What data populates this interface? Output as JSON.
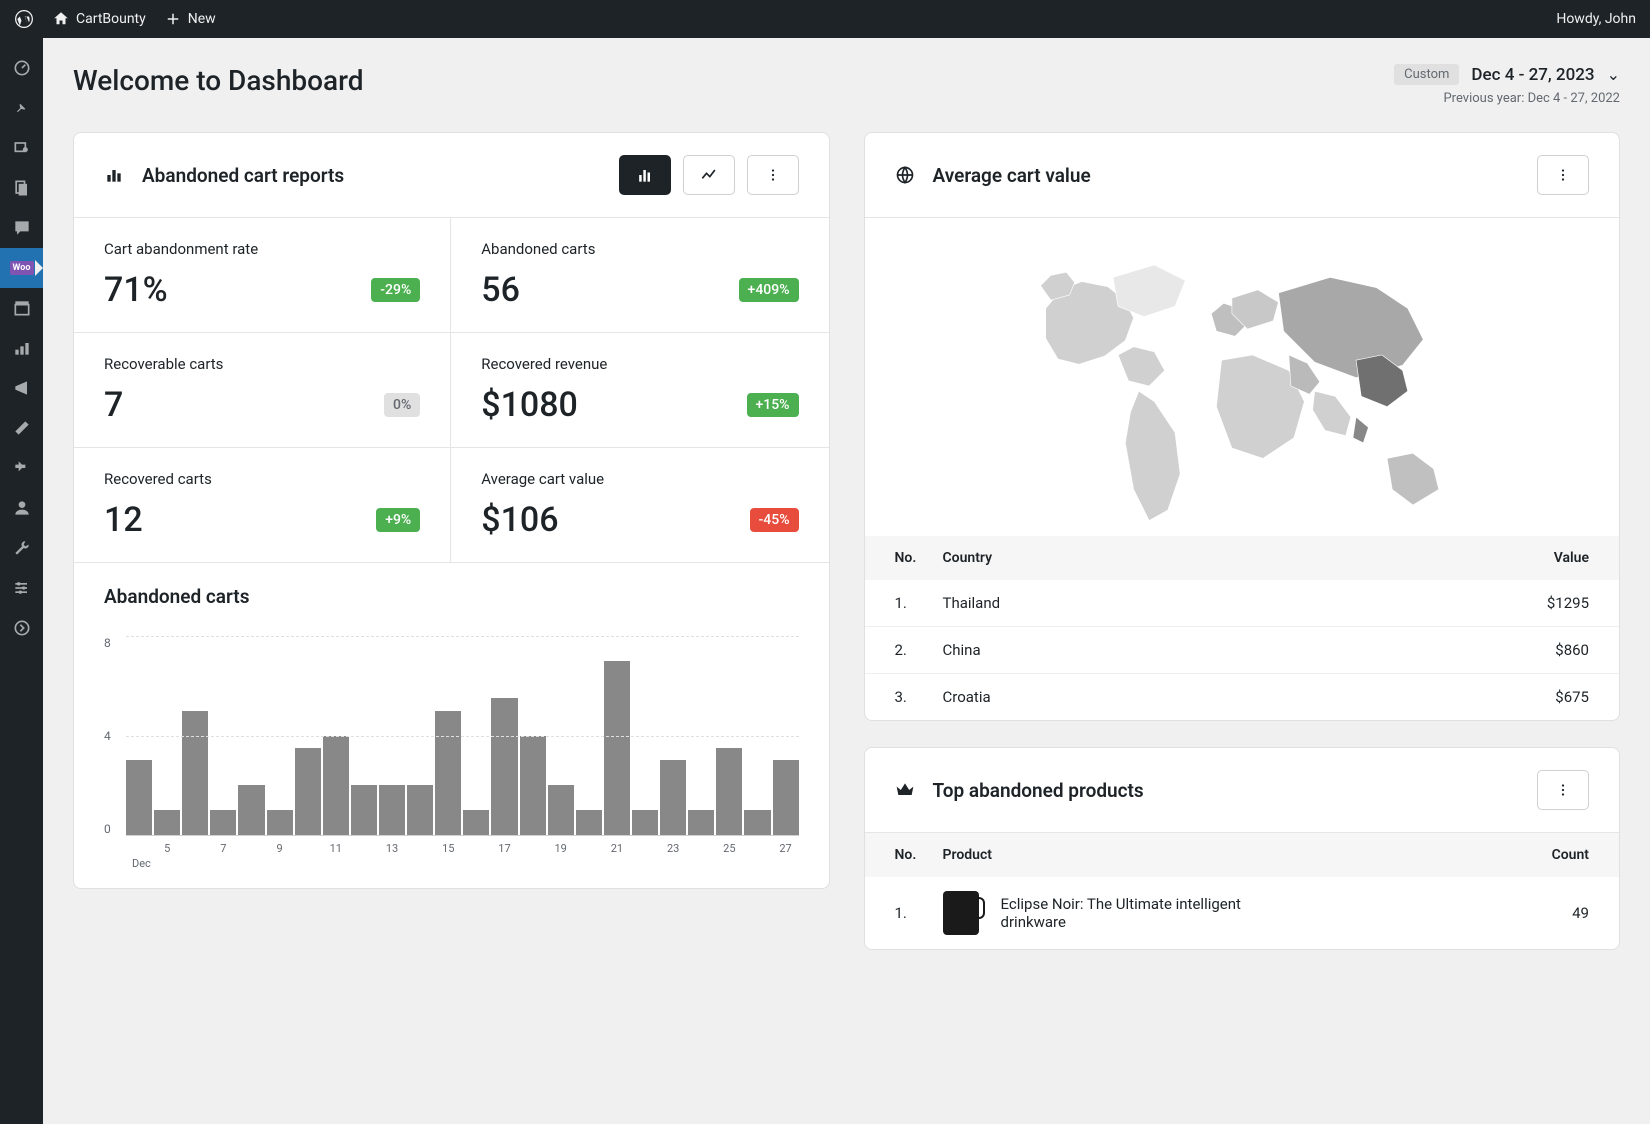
{
  "admin_bar": {
    "site_name": "CartBounty",
    "new_label": "New",
    "greeting": "Howdy, John"
  },
  "header": {
    "title": "Welcome to Dashboard",
    "custom_badge": "Custom",
    "date_range": "Dec 4 - 27, 2023",
    "previous_year": "Previous year: Dec 4 - 27, 2022"
  },
  "reports_card": {
    "title": "Abandoned cart reports",
    "stats": [
      {
        "label": "Cart abandonment rate",
        "value": "71%",
        "change": "-29%",
        "change_color": "green"
      },
      {
        "label": "Abandoned carts",
        "value": "56",
        "change": "+409%",
        "change_color": "green"
      },
      {
        "label": "Recoverable carts",
        "value": "7",
        "change": "0%",
        "change_color": "gray"
      },
      {
        "label": "Recovered revenue",
        "value": "$1080",
        "change": "+15%",
        "change_color": "green"
      },
      {
        "label": "Recovered carts",
        "value": "12",
        "change": "+9%",
        "change_color": "green"
      },
      {
        "label": "Average cart value",
        "value": "$106",
        "change": "-45%",
        "change_color": "red"
      }
    ]
  },
  "chart": {
    "title": "Abandoned carts",
    "y_ticks": [
      "8",
      "4",
      "0"
    ],
    "x_month": "Dec"
  },
  "chart_data": {
    "type": "bar",
    "title": "Abandoned carts",
    "xlabel": "Dec",
    "ylabel": "",
    "ylim": [
      0,
      8
    ],
    "categories": [
      "4",
      "5",
      "6",
      "7",
      "8",
      "9",
      "10",
      "11",
      "12",
      "13",
      "14",
      "15",
      "16",
      "17",
      "18",
      "19",
      "20",
      "21",
      "22",
      "23",
      "24",
      "25",
      "26",
      "27"
    ],
    "x_tick_labels": [
      "",
      "5",
      "",
      "7",
      "",
      "9",
      "",
      "11",
      "",
      "13",
      "",
      "15",
      "",
      "17",
      "",
      "19",
      "",
      "21",
      "",
      "23",
      "",
      "25",
      "",
      "27"
    ],
    "values": [
      3,
      1,
      5,
      1,
      2,
      1,
      3.5,
      4,
      2,
      2,
      2,
      5,
      1,
      5.5,
      4,
      2,
      1,
      7,
      1,
      3,
      1,
      3.5,
      1,
      3
    ]
  },
  "map_card": {
    "title": "Average cart value",
    "columns": {
      "no": "No.",
      "country": "Country",
      "value": "Value"
    },
    "rows": [
      {
        "no": "1.",
        "country": "Thailand",
        "value": "$1295"
      },
      {
        "no": "2.",
        "country": "China",
        "value": "$860"
      },
      {
        "no": "3.",
        "country": "Croatia",
        "value": "$675"
      }
    ]
  },
  "products_card": {
    "title": "Top abandoned products",
    "columns": {
      "no": "No.",
      "product": "Product",
      "count": "Count"
    },
    "rows": [
      {
        "no": "1.",
        "name": "Eclipse Noir: The Ultimate intelligent drinkware",
        "count": "49"
      }
    ]
  }
}
